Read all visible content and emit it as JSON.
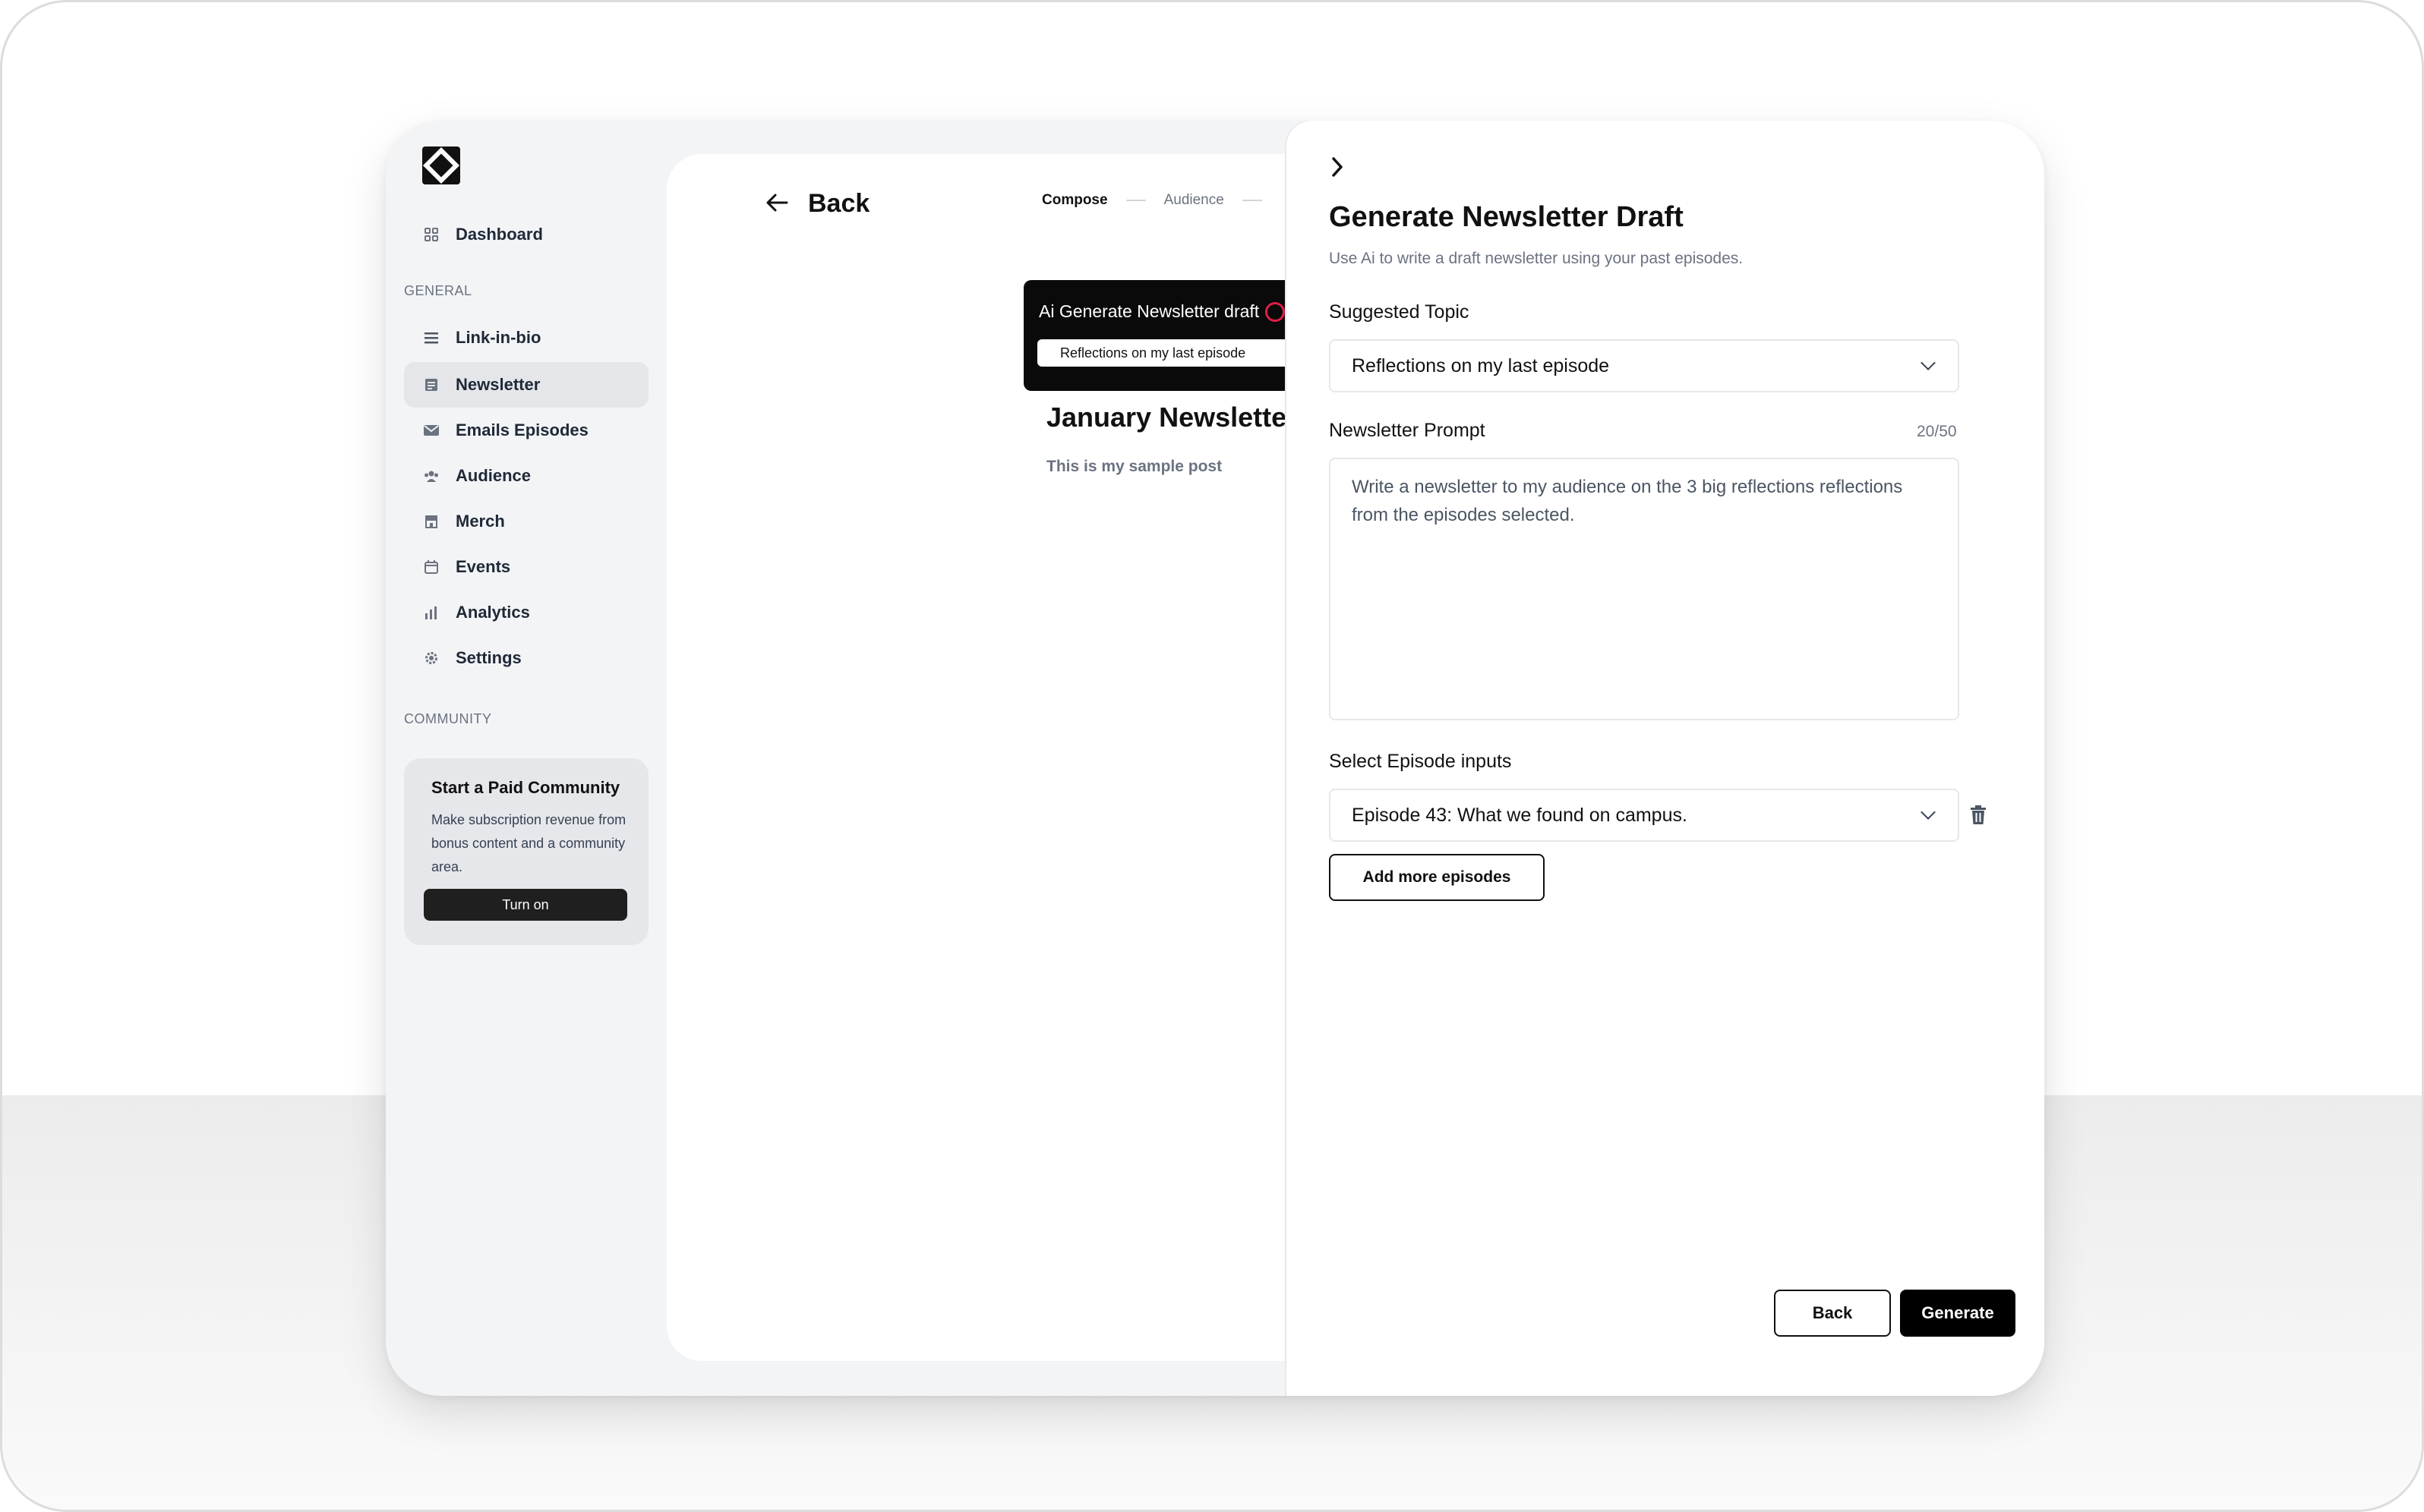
{
  "sidebar": {
    "dashboard_label": "Dashboard",
    "general_heading": "GENERAL",
    "items": [
      {
        "label": "Link-in-bio",
        "icon": "list-icon"
      },
      {
        "label": "Newsletter",
        "icon": "newspaper-icon"
      },
      {
        "label": "Emails Episodes",
        "icon": "mail-icon"
      },
      {
        "label": "Audience",
        "icon": "users-icon"
      },
      {
        "label": "Merch",
        "icon": "store-icon"
      },
      {
        "label": "Events",
        "icon": "calendar-icon"
      },
      {
        "label": "Analytics",
        "icon": "bar-chart-icon"
      },
      {
        "label": "Settings",
        "icon": "gear-icon"
      }
    ],
    "active_item": "Newsletter",
    "community_heading": "COMMUNITY",
    "community_card": {
      "title": "Start a Paid Community",
      "description": "Make subscription revenue from bonus content and a community area.",
      "button_label": "Turn on"
    }
  },
  "main": {
    "back_label": "Back",
    "steps": [
      "Compose",
      "Audience"
    ],
    "active_step": "Compose",
    "ai_banner": {
      "title": "Ai Generate Newsletter draft",
      "suggestion": "Reflections on my last episode"
    },
    "newsletter_title": "January Newsletter",
    "newsletter_body": "This is my sample post"
  },
  "drawer": {
    "title": "Generate Newsletter Draft",
    "subtitle": "Use Ai to write a draft newsletter using your past episodes.",
    "suggested_topic_label": "Suggested Topic",
    "suggested_topic_value": "Reflections on my last episode",
    "prompt_label": "Newsletter Prompt",
    "prompt_counter": "20/50",
    "prompt_value": "Write a newsletter to my audience on the 3 big reflections reflections from the episodes selected.",
    "episode_label": "Select Episode inputs",
    "episode_value": "Episode 43: What we found on campus.",
    "add_more_label": "Add more episodes",
    "back_button": "Back",
    "generate_button": "Generate"
  },
  "colors": {
    "accent": "#000000",
    "sidebar_bg": "#f3f4f6",
    "active_nav_bg": "#e4e6ea",
    "ai_icon_red": "#e11d48"
  }
}
